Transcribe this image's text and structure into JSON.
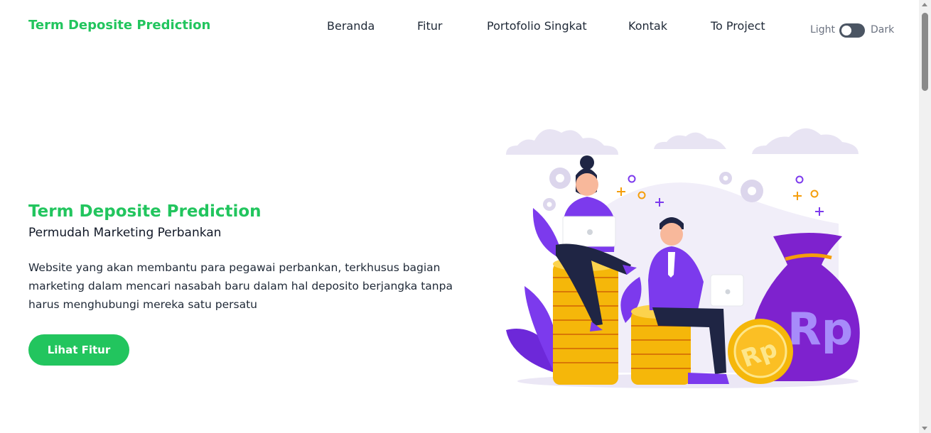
{
  "nav": {
    "brand": "Term Deposite Prediction",
    "links": [
      "Beranda",
      "Fitur",
      "Portofolio Singkat",
      "Kontak",
      "To Project"
    ]
  },
  "theme_toggle": {
    "light_label": "Light",
    "dark_label": "Dark"
  },
  "hero": {
    "title": "Term Deposite Prediction",
    "subtitle": "Permudah Marketing Perbankan",
    "description": "Website yang akan membantu para pegawai perbankan, terkhusus bagian marketing dalam mencari nasabah baru dalam hal deposito berjangka tanpa harus menghubungi mereka satu persatu",
    "cta_label": "Lihat Fitur"
  },
  "illustration": {
    "coin_text": "Rp",
    "bag_text": "Rp"
  },
  "colors": {
    "accent": "#22c55e",
    "purple": "#7c3aed",
    "gold": "#fbbf24"
  }
}
